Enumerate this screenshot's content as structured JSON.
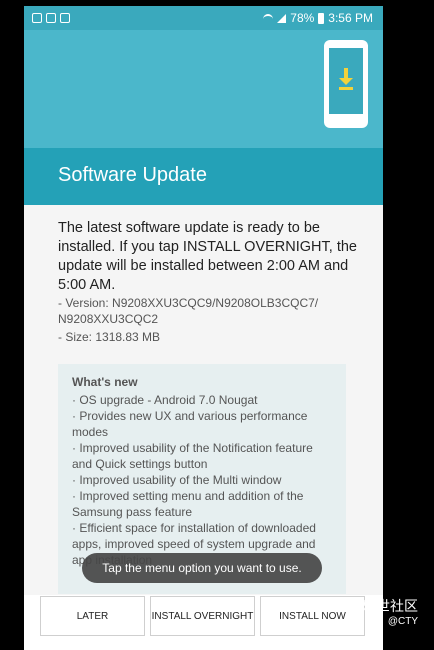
{
  "status_bar": {
    "battery": "78%",
    "time": "3:56 PM"
  },
  "header": {
    "title": "Software Update"
  },
  "content": {
    "intro": "The latest software update is ready to be installed. If you tap INSTALL OVERNIGHT, the update will be installed between 2:00 AM and 5:00 AM.",
    "version": "- Version: N9208XXU3CQC9/N9208OLB3CQC7/ N9208XXU3CQC2",
    "size": "- Size: 1318.83 MB"
  },
  "whats_new": {
    "title": "What's new",
    "items": [
      "· OS upgrade - Android 7.0 Nougat",
      "· Provides new UX and various performance modes",
      "· Improved usability of the Notification feature and Quick settings button",
      "· Improved usability of the Multi window",
      "· Improved setting menu and addition of the Samsung pass feature",
      "· Efficient space for installation of downloaded apps, improved speed of system upgrade and app installation"
    ]
  },
  "toast": {
    "text": "Tap the menu option you want to use."
  },
  "buttons": {
    "later": "LATER",
    "overnight": "INSTALL OVERNIGHT",
    "now": "INSTALL NOW"
  },
  "watermark": {
    "text": "盖乐世社区",
    "sub": "@CTY"
  },
  "colors": {
    "accent": "#24a1b7",
    "hero": "#4bb7cb",
    "status_bar": "#3aa9bd"
  }
}
